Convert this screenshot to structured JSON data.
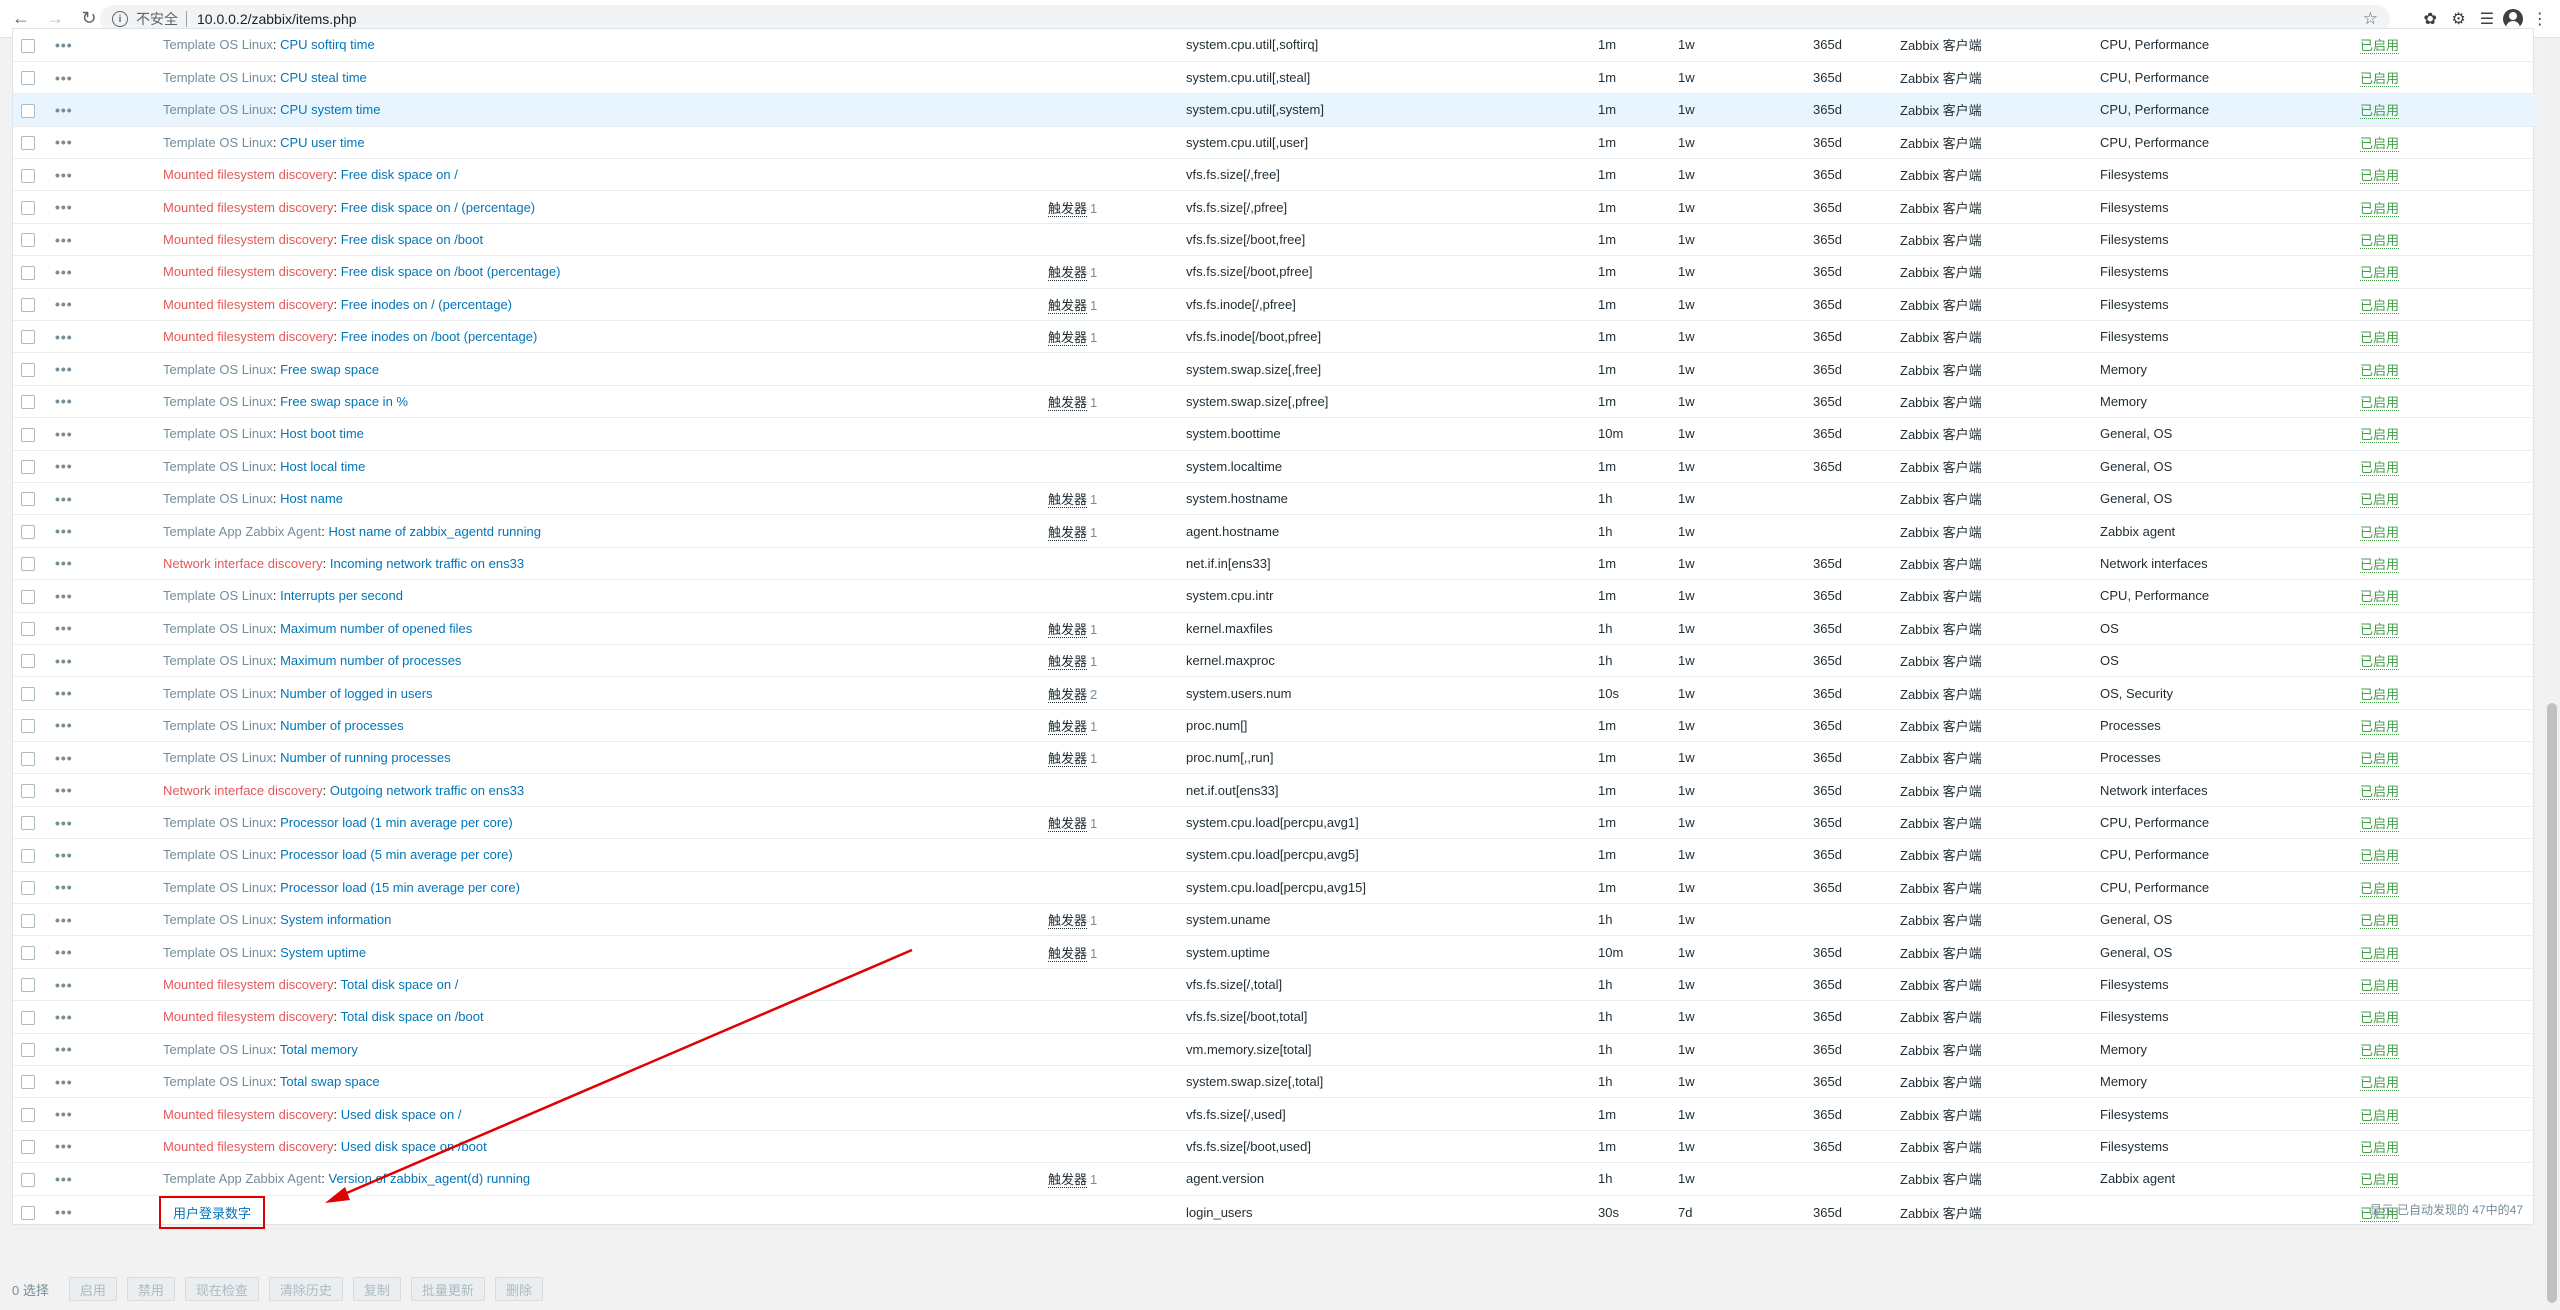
{
  "browser": {
    "insecure_label": "不安全",
    "url": "10.0.0.2/zabbix/items.php"
  },
  "items": [
    {
      "tpl": "Template OS Linux",
      "tpl_style": "gray",
      "name": "CPU softirq time",
      "trig": "",
      "trig_count": "",
      "key": "system.cpu.util[,softirq]",
      "interval": "1m",
      "history": "1w",
      "trends": "365d",
      "type": "Zabbix 客户端",
      "app": "CPU, Performance",
      "status": "已启用"
    },
    {
      "tpl": "Template OS Linux",
      "tpl_style": "gray",
      "name": "CPU steal time",
      "trig": "",
      "trig_count": "",
      "key": "system.cpu.util[,steal]",
      "interval": "1m",
      "history": "1w",
      "trends": "365d",
      "type": "Zabbix 客户端",
      "app": "CPU, Performance",
      "status": "已启用"
    },
    {
      "tpl": "Template OS Linux",
      "tpl_style": "gray",
      "name": "CPU system time",
      "trig": "",
      "trig_count": "",
      "key": "system.cpu.util[,system]",
      "interval": "1m",
      "history": "1w",
      "trends": "365d",
      "type": "Zabbix 客户端",
      "app": "CPU, Performance",
      "status": "已启用",
      "highlight": true
    },
    {
      "tpl": "Template OS Linux",
      "tpl_style": "gray",
      "name": "CPU user time",
      "trig": "",
      "trig_count": "",
      "key": "system.cpu.util[,user]",
      "interval": "1m",
      "history": "1w",
      "trends": "365d",
      "type": "Zabbix 客户端",
      "app": "CPU, Performance",
      "status": "已启用"
    },
    {
      "tpl": "Mounted filesystem discovery",
      "tpl_style": "orange",
      "name": "Free disk space on /",
      "trig": "",
      "trig_count": "",
      "key": "vfs.fs.size[/,free]",
      "interval": "1m",
      "history": "1w",
      "trends": "365d",
      "type": "Zabbix 客户端",
      "app": "Filesystems",
      "status": "已启用"
    },
    {
      "tpl": "Mounted filesystem discovery",
      "tpl_style": "orange",
      "name": "Free disk space on / (percentage)",
      "trig": "触发器",
      "trig_count": "1",
      "key": "vfs.fs.size[/,pfree]",
      "interval": "1m",
      "history": "1w",
      "trends": "365d",
      "type": "Zabbix 客户端",
      "app": "Filesystems",
      "status": "已启用"
    },
    {
      "tpl": "Mounted filesystem discovery",
      "tpl_style": "orange",
      "name": "Free disk space on /boot",
      "trig": "",
      "trig_count": "",
      "key": "vfs.fs.size[/boot,free]",
      "interval": "1m",
      "history": "1w",
      "trends": "365d",
      "type": "Zabbix 客户端",
      "app": "Filesystems",
      "status": "已启用"
    },
    {
      "tpl": "Mounted filesystem discovery",
      "tpl_style": "orange",
      "name": "Free disk space on /boot (percentage)",
      "trig": "触发器",
      "trig_count": "1",
      "key": "vfs.fs.size[/boot,pfree]",
      "interval": "1m",
      "history": "1w",
      "trends": "365d",
      "type": "Zabbix 客户端",
      "app": "Filesystems",
      "status": "已启用"
    },
    {
      "tpl": "Mounted filesystem discovery",
      "tpl_style": "orange",
      "name": "Free inodes on / (percentage)",
      "trig": "触发器",
      "trig_count": "1",
      "key": "vfs.fs.inode[/,pfree]",
      "interval": "1m",
      "history": "1w",
      "trends": "365d",
      "type": "Zabbix 客户端",
      "app": "Filesystems",
      "status": "已启用"
    },
    {
      "tpl": "Mounted filesystem discovery",
      "tpl_style": "orange",
      "name": "Free inodes on /boot (percentage)",
      "trig": "触发器",
      "trig_count": "1",
      "key": "vfs.fs.inode[/boot,pfree]",
      "interval": "1m",
      "history": "1w",
      "trends": "365d",
      "type": "Zabbix 客户端",
      "app": "Filesystems",
      "status": "已启用"
    },
    {
      "tpl": "Template OS Linux",
      "tpl_style": "gray",
      "name": "Free swap space",
      "trig": "",
      "trig_count": "",
      "key": "system.swap.size[,free]",
      "interval": "1m",
      "history": "1w",
      "trends": "365d",
      "type": "Zabbix 客户端",
      "app": "Memory",
      "status": "已启用"
    },
    {
      "tpl": "Template OS Linux",
      "tpl_style": "gray",
      "name": "Free swap space in %",
      "trig": "触发器",
      "trig_count": "1",
      "key": "system.swap.size[,pfree]",
      "interval": "1m",
      "history": "1w",
      "trends": "365d",
      "type": "Zabbix 客户端",
      "app": "Memory",
      "status": "已启用"
    },
    {
      "tpl": "Template OS Linux",
      "tpl_style": "gray",
      "name": "Host boot time",
      "trig": "",
      "trig_count": "",
      "key": "system.boottime",
      "interval": "10m",
      "history": "1w",
      "trends": "365d",
      "type": "Zabbix 客户端",
      "app": "General, OS",
      "status": "已启用"
    },
    {
      "tpl": "Template OS Linux",
      "tpl_style": "gray",
      "name": "Host local time",
      "trig": "",
      "trig_count": "",
      "key": "system.localtime",
      "interval": "1m",
      "history": "1w",
      "trends": "365d",
      "type": "Zabbix 客户端",
      "app": "General, OS",
      "status": "已启用"
    },
    {
      "tpl": "Template OS Linux",
      "tpl_style": "gray",
      "name": "Host name",
      "trig": "触发器",
      "trig_count": "1",
      "key": "system.hostname",
      "interval": "1h",
      "history": "1w",
      "trends": "",
      "type": "Zabbix 客户端",
      "app": "General, OS",
      "status": "已启用"
    },
    {
      "tpl": "Template App Zabbix Agent",
      "tpl_style": "gray",
      "name": "Host name of zabbix_agentd running",
      "trig": "触发器",
      "trig_count": "1",
      "key": "agent.hostname",
      "interval": "1h",
      "history": "1w",
      "trends": "",
      "type": "Zabbix 客户端",
      "app": "Zabbix agent",
      "status": "已启用"
    },
    {
      "tpl": "Network interface discovery",
      "tpl_style": "orange",
      "name": "Incoming network traffic on ens33",
      "trig": "",
      "trig_count": "",
      "key": "net.if.in[ens33]",
      "interval": "1m",
      "history": "1w",
      "trends": "365d",
      "type": "Zabbix 客户端",
      "app": "Network interfaces",
      "status": "已启用"
    },
    {
      "tpl": "Template OS Linux",
      "tpl_style": "gray",
      "name": "Interrupts per second",
      "trig": "",
      "trig_count": "",
      "key": "system.cpu.intr",
      "interval": "1m",
      "history": "1w",
      "trends": "365d",
      "type": "Zabbix 客户端",
      "app": "CPU, Performance",
      "status": "已启用"
    },
    {
      "tpl": "Template OS Linux",
      "tpl_style": "gray",
      "name": "Maximum number of opened files",
      "trig": "触发器",
      "trig_count": "1",
      "key": "kernel.maxfiles",
      "interval": "1h",
      "history": "1w",
      "trends": "365d",
      "type": "Zabbix 客户端",
      "app": "OS",
      "status": "已启用"
    },
    {
      "tpl": "Template OS Linux",
      "tpl_style": "gray",
      "name": "Maximum number of processes",
      "trig": "触发器",
      "trig_count": "1",
      "key": "kernel.maxproc",
      "interval": "1h",
      "history": "1w",
      "trends": "365d",
      "type": "Zabbix 客户端",
      "app": "OS",
      "status": "已启用"
    },
    {
      "tpl": "Template OS Linux",
      "tpl_style": "gray",
      "name": "Number of logged in users",
      "trig": "触发器",
      "trig_count": "2",
      "key": "system.users.num",
      "interval": "10s",
      "history": "1w",
      "trends": "365d",
      "type": "Zabbix 客户端",
      "app": "OS, Security",
      "status": "已启用"
    },
    {
      "tpl": "Template OS Linux",
      "tpl_style": "gray",
      "name": "Number of processes",
      "trig": "触发器",
      "trig_count": "1",
      "key": "proc.num[]",
      "interval": "1m",
      "history": "1w",
      "trends": "365d",
      "type": "Zabbix 客户端",
      "app": "Processes",
      "status": "已启用"
    },
    {
      "tpl": "Template OS Linux",
      "tpl_style": "gray",
      "name": "Number of running processes",
      "trig": "触发器",
      "trig_count": "1",
      "key": "proc.num[,,run]",
      "interval": "1m",
      "history": "1w",
      "trends": "365d",
      "type": "Zabbix 客户端",
      "app": "Processes",
      "status": "已启用"
    },
    {
      "tpl": "Network interface discovery",
      "tpl_style": "orange",
      "name": "Outgoing network traffic on ens33",
      "trig": "",
      "trig_count": "",
      "key": "net.if.out[ens33]",
      "interval": "1m",
      "history": "1w",
      "trends": "365d",
      "type": "Zabbix 客户端",
      "app": "Network interfaces",
      "status": "已启用"
    },
    {
      "tpl": "Template OS Linux",
      "tpl_style": "gray",
      "name": "Processor load (1 min average per core)",
      "trig": "触发器",
      "trig_count": "1",
      "key": "system.cpu.load[percpu,avg1]",
      "interval": "1m",
      "history": "1w",
      "trends": "365d",
      "type": "Zabbix 客户端",
      "app": "CPU, Performance",
      "status": "已启用"
    },
    {
      "tpl": "Template OS Linux",
      "tpl_style": "gray",
      "name": "Processor load (5 min average per core)",
      "trig": "",
      "trig_count": "",
      "key": "system.cpu.load[percpu,avg5]",
      "interval": "1m",
      "history": "1w",
      "trends": "365d",
      "type": "Zabbix 客户端",
      "app": "CPU, Performance",
      "status": "已启用"
    },
    {
      "tpl": "Template OS Linux",
      "tpl_style": "gray",
      "name": "Processor load (15 min average per core)",
      "trig": "",
      "trig_count": "",
      "key": "system.cpu.load[percpu,avg15]",
      "interval": "1m",
      "history": "1w",
      "trends": "365d",
      "type": "Zabbix 客户端",
      "app": "CPU, Performance",
      "status": "已启用"
    },
    {
      "tpl": "Template OS Linux",
      "tpl_style": "gray",
      "name": "System information",
      "trig": "触发器",
      "trig_count": "1",
      "key": "system.uname",
      "interval": "1h",
      "history": "1w",
      "trends": "",
      "type": "Zabbix 客户端",
      "app": "General, OS",
      "status": "已启用"
    },
    {
      "tpl": "Template OS Linux",
      "tpl_style": "gray",
      "name": "System uptime",
      "trig": "触发器",
      "trig_count": "1",
      "key": "system.uptime",
      "interval": "10m",
      "history": "1w",
      "trends": "365d",
      "type": "Zabbix 客户端",
      "app": "General, OS",
      "status": "已启用"
    },
    {
      "tpl": "Mounted filesystem discovery",
      "tpl_style": "orange",
      "name": "Total disk space on /",
      "trig": "",
      "trig_count": "",
      "key": "vfs.fs.size[/,total]",
      "interval": "1h",
      "history": "1w",
      "trends": "365d",
      "type": "Zabbix 客户端",
      "app": "Filesystems",
      "status": "已启用"
    },
    {
      "tpl": "Mounted filesystem discovery",
      "tpl_style": "orange",
      "name": "Total disk space on /boot",
      "trig": "",
      "trig_count": "",
      "key": "vfs.fs.size[/boot,total]",
      "interval": "1h",
      "history": "1w",
      "trends": "365d",
      "type": "Zabbix 客户端",
      "app": "Filesystems",
      "status": "已启用"
    },
    {
      "tpl": "Template OS Linux",
      "tpl_style": "gray",
      "name": "Total memory",
      "trig": "",
      "trig_count": "",
      "key": "vm.memory.size[total]",
      "interval": "1h",
      "history": "1w",
      "trends": "365d",
      "type": "Zabbix 客户端",
      "app": "Memory",
      "status": "已启用"
    },
    {
      "tpl": "Template OS Linux",
      "tpl_style": "gray",
      "name": "Total swap space",
      "trig": "",
      "trig_count": "",
      "key": "system.swap.size[,total]",
      "interval": "1h",
      "history": "1w",
      "trends": "365d",
      "type": "Zabbix 客户端",
      "app": "Memory",
      "status": "已启用"
    },
    {
      "tpl": "Mounted filesystem discovery",
      "tpl_style": "orange",
      "name": "Used disk space on /",
      "trig": "",
      "trig_count": "",
      "key": "vfs.fs.size[/,used]",
      "interval": "1m",
      "history": "1w",
      "trends": "365d",
      "type": "Zabbix 客户端",
      "app": "Filesystems",
      "status": "已启用"
    },
    {
      "tpl": "Mounted filesystem discovery",
      "tpl_style": "orange",
      "name": "Used disk space on /boot",
      "trig": "",
      "trig_count": "",
      "key": "vfs.fs.size[/boot,used]",
      "interval": "1m",
      "history": "1w",
      "trends": "365d",
      "type": "Zabbix 客户端",
      "app": "Filesystems",
      "status": "已启用"
    },
    {
      "tpl": "Template App Zabbix Agent",
      "tpl_style": "gray",
      "name": "Version of zabbix_agent(d) running",
      "trig": "触发器",
      "trig_count": "1",
      "key": "agent.version",
      "interval": "1h",
      "history": "1w",
      "trends": "",
      "type": "Zabbix 客户端",
      "app": "Zabbix agent",
      "status": "已启用"
    },
    {
      "tpl": "",
      "tpl_style": "none",
      "name": "用户登录数字",
      "trig": "",
      "trig_count": "",
      "key": "login_users",
      "interval": "30s",
      "history": "7d",
      "trends": "365d",
      "type": "Zabbix 客户端",
      "app": "",
      "status": "已启用",
      "boxed": true
    }
  ],
  "footer": {
    "summary": "显示 已自动发现的 47中的47"
  },
  "actions": {
    "selected": "0 选择",
    "enable": "启用",
    "disable": "禁用",
    "check_now": "现在检查",
    "clear_history": "清除历史",
    "copy": "复制",
    "mass_update": "批量更新",
    "delete": "删除"
  },
  "colors": {
    "link": "#0275b8",
    "template_gray": "#768d99",
    "template_orange": "#e45959",
    "status_enabled": "#429e47",
    "highlight_row": "#e8f5ff",
    "annotation_red": "#e00000"
  }
}
